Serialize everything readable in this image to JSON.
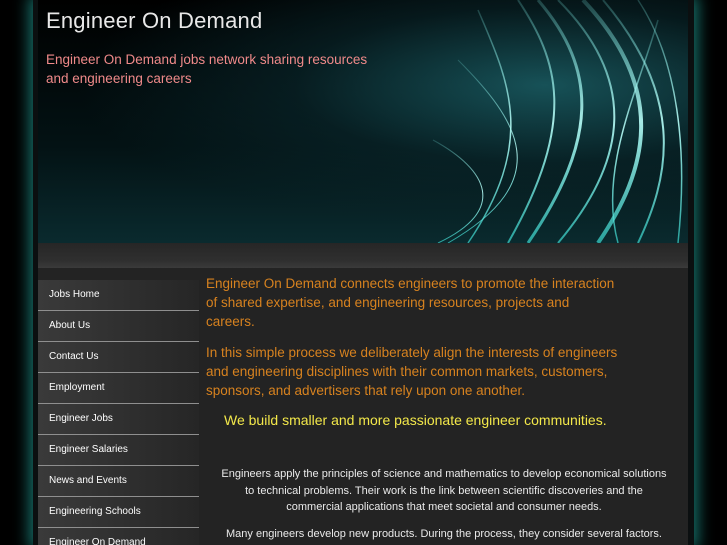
{
  "header": {
    "site_title": "Engineer On Demand",
    "tagline": "Engineer On Demand jobs network sharing resources and engineering careers"
  },
  "sidebar": {
    "items": [
      {
        "label": "Jobs Home"
      },
      {
        "label": "About Us"
      },
      {
        "label": "Contact Us"
      },
      {
        "label": "Employment"
      },
      {
        "label": "Engineer Jobs"
      },
      {
        "label": "Engineer Salaries"
      },
      {
        "label": "News and Events"
      },
      {
        "label": "Engineering Schools"
      },
      {
        "label": "Engineer On Demand"
      }
    ]
  },
  "main": {
    "intro_1": "Engineer On Demand connects engineers to promote the interaction of shared expertise, and engineering resources, projects and careers.",
    "intro_2": "In this simple process we deliberately align the interests of engineers and engineering disciplines with their common markets, customers, sponsors, and advertisers that rely upon one another.",
    "highlight": "We build smaller and more passionate engineer communities.",
    "body_1": "Engineers apply the principles of science and mathematics to develop economical solutions to technical problems. Their work is the link between scientific discoveries and the commercial applications that meet societal and consumer needs.",
    "body_2": "Many engineers develop new products. During the process, they consider several factors. For"
  },
  "colors": {
    "glow": "#28c8be",
    "tagline": "#f08a8a",
    "lead": "#d7821f",
    "highlight": "#f3e84a"
  }
}
